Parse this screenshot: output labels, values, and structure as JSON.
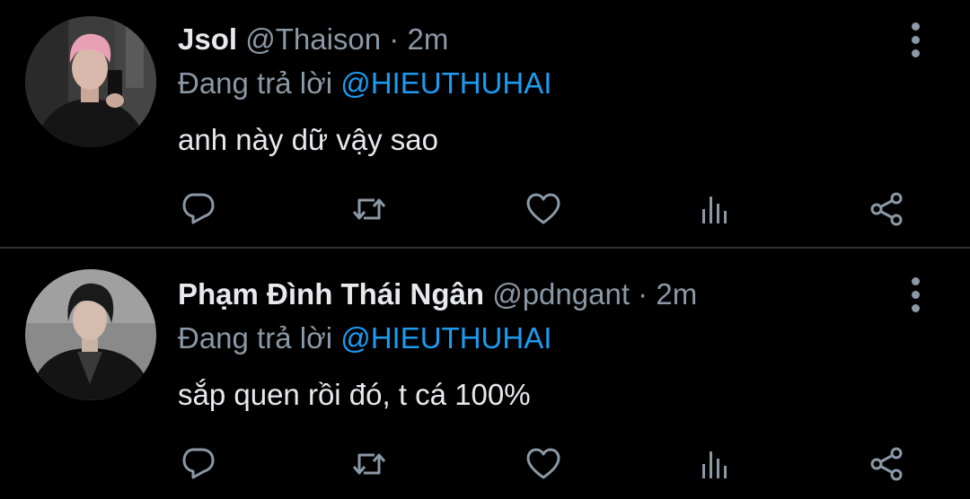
{
  "colors": {
    "background": "#000000",
    "primary_text": "#e7e9ea",
    "secondary_text": "#8b98a5",
    "mention": "#1d9bf0",
    "divider": "#2f3336"
  },
  "action_icons": [
    "reply-icon",
    "retweet-icon",
    "like-icon",
    "stats-icon",
    "share-icon"
  ],
  "tweets": [
    {
      "display_name": "Jsol",
      "handle": "@Thaison",
      "separator": "·",
      "time": "2m",
      "reply_prefix": "Đang trả lời",
      "reply_to": "@HIEUTHUHAI",
      "text": "anh này dữ vậy sao"
    },
    {
      "display_name": "Phạm Đình Thái Ngân",
      "handle": "@pdngant",
      "separator": "·",
      "time": "2m",
      "reply_prefix": "Đang trả lời",
      "reply_to": "@HIEUTHUHAI",
      "text": "sắp quen rồi đó, t cá 100%"
    }
  ]
}
